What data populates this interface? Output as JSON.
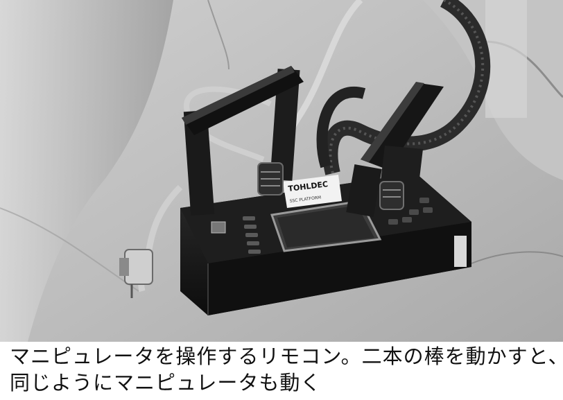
{
  "photo": {
    "label_brand": "TOHLDEC",
    "label_sub": "SSC PLATFORM"
  },
  "caption": {
    "line1": "マニピュレータを操作するリモコン。二本の棒を動かすと、",
    "line2": "同じようにマニピュレータも動く"
  }
}
